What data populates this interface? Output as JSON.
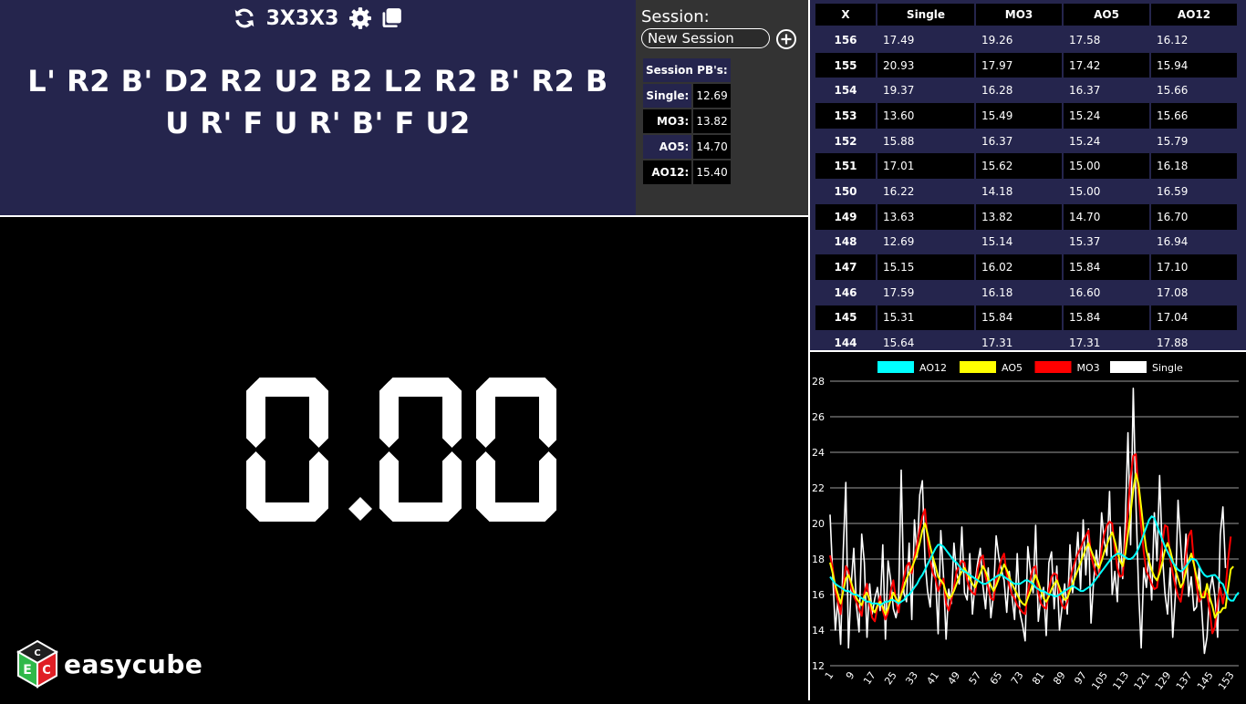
{
  "header": {
    "puzzle": "3X3X3",
    "icons": [
      "refresh-icon",
      "gear-icon",
      "copy-icon"
    ]
  },
  "scramble": "L' R2 B' D2 R2 U2 B2 L2 R2 B' R2 B U R' F U R' B' F U2",
  "session": {
    "title": "Session:",
    "current": "New Session",
    "pb_title": "Session PB's:",
    "pbs": [
      {
        "label": "Single:",
        "value": "12.69"
      },
      {
        "label": "MO3:",
        "value": "13.82"
      },
      {
        "label": "AO5:",
        "value": "14.70"
      },
      {
        "label": "AO12:",
        "value": "15.40"
      }
    ]
  },
  "timer": {
    "display": "0.00"
  },
  "logo": {
    "text": "easycube"
  },
  "times_table": {
    "columns": [
      "X",
      "Single",
      "MO3",
      "AO5",
      "AO12"
    ],
    "rows": [
      [
        "156",
        "17.49",
        "19.26",
        "17.58",
        "16.12"
      ],
      [
        "155",
        "20.93",
        "17.97",
        "17.42",
        "15.94"
      ],
      [
        "154",
        "19.37",
        "16.28",
        "16.37",
        "15.66"
      ],
      [
        "153",
        "13.60",
        "15.49",
        "15.24",
        "15.66"
      ],
      [
        "152",
        "15.88",
        "16.37",
        "15.24",
        "15.79"
      ],
      [
        "151",
        "17.01",
        "15.62",
        "15.00",
        "16.18"
      ],
      [
        "150",
        "16.22",
        "14.18",
        "15.00",
        "16.59"
      ],
      [
        "149",
        "13.63",
        "13.82",
        "14.70",
        "16.70"
      ],
      [
        "148",
        "12.69",
        "15.14",
        "15.37",
        "16.94"
      ],
      [
        "147",
        "15.15",
        "16.02",
        "15.84",
        "17.10"
      ],
      [
        "146",
        "17.59",
        "16.18",
        "16.60",
        "17.08"
      ],
      [
        "145",
        "15.31",
        "15.84",
        "15.84",
        "17.04"
      ],
      [
        "144",
        "15.64",
        "17.31",
        "17.31",
        "17.88"
      ]
    ]
  },
  "chart_data": {
    "type": "line",
    "ylim": [
      12,
      28
    ],
    "yticks": [
      12,
      14,
      16,
      18,
      20,
      22,
      24,
      26,
      28
    ],
    "xticks": [
      1,
      9,
      17,
      25,
      33,
      41,
      49,
      57,
      65,
      73,
      81,
      89,
      97,
      105,
      113,
      121,
      129,
      137,
      145,
      153
    ],
    "xlim": [
      1,
      156
    ],
    "grid": true,
    "legend_position": "top",
    "series": [
      {
        "name": "AO12",
        "color": "#00ffff",
        "values": [
          17.0,
          16.8,
          16.6,
          16.5,
          16.4,
          16.3,
          16.2,
          16.2,
          16.1,
          16.0,
          16.0,
          15.9,
          15.8,
          15.7,
          15.6,
          15.6,
          15.5,
          15.5,
          15.5,
          15.4,
          15.5,
          15.6,
          15.6,
          15.7,
          15.7,
          15.6,
          15.5,
          15.6,
          15.7,
          15.9,
          16.0,
          16.2,
          16.4,
          16.6,
          16.9,
          17.1,
          17.4,
          17.7,
          18.0,
          18.3,
          18.6,
          18.8,
          18.8,
          18.7,
          18.5,
          18.3,
          18.1,
          17.9,
          17.8,
          17.6,
          17.4,
          17.3,
          17.2,
          17.1,
          17.0,
          16.9,
          16.8,
          16.7,
          16.6,
          16.6,
          16.7,
          16.8,
          16.9,
          17.0,
          17.1,
          17.1,
          17.0,
          16.9,
          16.8,
          16.7,
          16.6,
          16.6,
          16.6,
          16.7,
          16.8,
          16.8,
          16.7,
          16.6,
          16.4,
          16.3,
          16.2,
          16.2,
          16.1,
          16.0,
          16.0,
          15.9,
          15.9,
          16.0,
          16.1,
          16.2,
          16.3,
          16.4,
          16.5,
          16.4,
          16.3,
          16.2,
          16.2,
          16.3,
          16.4,
          16.5,
          16.7,
          16.9,
          17.1,
          17.3,
          17.5,
          17.7,
          17.9,
          18.1,
          18.2,
          18.3,
          18.3,
          18.2,
          18.1,
          18.0,
          18.0,
          18.1,
          18.3,
          18.6,
          19.0,
          19.4,
          19.8,
          20.2,
          20.4,
          20.3,
          19.9,
          19.5,
          19.1,
          18.7,
          18.4,
          18.1,
          17.8,
          17.6,
          17.4,
          17.3,
          17.4,
          17.6,
          17.8,
          18.0,
          18.0,
          17.9,
          17.6,
          17.3,
          17.1,
          17.0,
          17.04,
          17.08,
          17.1,
          16.94,
          16.7,
          16.59,
          16.18,
          15.79,
          15.66,
          15.66,
          15.94,
          16.12
        ]
      },
      {
        "name": "AO5",
        "color": "#ffff00",
        "values": [
          17.8,
          17.2,
          16.5,
          16.0,
          15.5,
          16.2,
          16.9,
          17.1,
          16.7,
          16.2,
          15.8,
          15.6,
          15.4,
          15.9,
          16.1,
          15.7,
          15.2,
          15.0,
          15.4,
          15.6,
          15.3,
          14.9,
          15.2,
          15.7,
          16.1,
          15.8,
          15.5,
          16.0,
          16.4,
          16.9,
          17.2,
          17.5,
          17.9,
          18.3,
          18.9,
          19.6,
          20.0,
          19.4,
          18.7,
          18.1,
          17.6,
          17.0,
          16.8,
          16.6,
          16.1,
          15.8,
          15.9,
          16.2,
          16.6,
          17.0,
          17.3,
          17.5,
          17.2,
          16.9,
          16.6,
          16.4,
          16.8,
          17.2,
          17.6,
          17.3,
          16.9,
          16.5,
          16.2,
          16.5,
          16.9,
          17.3,
          17.7,
          17.4,
          17.0,
          16.6,
          16.3,
          16.0,
          15.7,
          15.5,
          15.4,
          15.8,
          16.2,
          16.7,
          17.1,
          16.7,
          16.2,
          15.8,
          15.6,
          15.9,
          16.3,
          16.6,
          16.8,
          16.4,
          16.0,
          15.7,
          15.8,
          16.2,
          16.6,
          17.0,
          17.4,
          17.8,
          18.2,
          18.6,
          18.9,
          18.5,
          18.1,
          17.7,
          17.5,
          17.9,
          18.4,
          18.8,
          19.2,
          19.5,
          19.0,
          18.4,
          17.9,
          17.6,
          18.3,
          19.4,
          20.6,
          21.9,
          22.8,
          22.2,
          20.9,
          19.6,
          18.5,
          17.9,
          17.4,
          17.0,
          16.8,
          17.2,
          17.8,
          18.5,
          18.9,
          18.5,
          17.9,
          17.4,
          16.9,
          16.4,
          16.7,
          17.3,
          17.9,
          18.3,
          17.7,
          17.0,
          16.4,
          15.84,
          15.84,
          16.6,
          15.84,
          15.37,
          14.7,
          15.0,
          15.0,
          15.24,
          15.24,
          16.37,
          17.42,
          17.58
        ]
      },
      {
        "name": "MO3",
        "color": "#ff0000",
        "values": [
          18.2,
          17.5,
          16.2,
          15.6,
          14.9,
          16.5,
          17.6,
          17.3,
          16.4,
          15.9,
          15.6,
          15.2,
          14.8,
          16.1,
          16.6,
          15.4,
          14.7,
          14.5,
          15.3,
          15.9,
          15.1,
          14.6,
          15.0,
          16.2,
          16.8,
          15.6,
          15.0,
          16.1,
          16.9,
          17.6,
          17.8,
          17.2,
          18.1,
          18.8,
          19.7,
          20.4,
          20.8,
          19.1,
          17.9,
          17.2,
          16.9,
          16.2,
          16.6,
          16.9,
          15.5,
          15.1,
          15.7,
          16.4,
          17.3,
          17.6,
          17.9,
          17.8,
          16.8,
          16.3,
          16.1,
          16.0,
          17.4,
          18.0,
          18.2,
          17.0,
          16.4,
          15.8,
          15.7,
          16.8,
          17.4,
          18.0,
          18.3,
          17.1,
          16.5,
          16.0,
          15.8,
          15.4,
          15.2,
          15.0,
          14.9,
          16.1,
          16.9,
          17.5,
          17.6,
          16.1,
          15.5,
          15.3,
          15.2,
          16.3,
          17.0,
          17.2,
          17.1,
          15.9,
          15.4,
          15.2,
          15.6,
          16.8,
          17.4,
          17.9,
          18.3,
          18.6,
          19.0,
          19.3,
          19.6,
          18.2,
          17.6,
          17.1,
          17.0,
          18.6,
          19.4,
          19.9,
          20.1,
          20.0,
          18.6,
          17.5,
          17.0,
          17.1,
          18.9,
          20.8,
          22.6,
          23.8,
          23.9,
          21.7,
          19.8,
          18.4,
          17.3,
          17.0,
          16.6,
          16.3,
          16.4,
          17.6,
          18.9,
          19.9,
          19.8,
          18.0,
          17.2,
          16.5,
          15.9,
          15.6,
          16.6,
          18.2,
          19.3,
          19.6,
          17.8,
          16.5,
          15.6,
          15.84,
          16.18,
          16.02,
          15.14,
          13.82,
          14.18,
          15.62,
          16.37,
          15.49,
          16.28,
          17.97,
          19.26
        ]
      },
      {
        "name": "Single",
        "color": "#ffffff",
        "values": [
          20.5,
          17.1,
          14.0,
          15.8,
          13.2,
          18.5,
          22.3,
          13.0,
          16.5,
          18.6,
          15.4,
          13.9,
          19.4,
          17.8,
          13.6,
          16.6,
          14.9,
          15.8,
          16.4,
          15.1,
          18.8,
          13.5,
          17.9,
          16.8,
          15.2,
          14.7,
          15.5,
          23.0,
          16.1,
          15.6,
          18.9,
          14.6,
          20.2,
          18.1,
          21.6,
          22.4,
          17.9,
          16.2,
          15.3,
          18.0,
          17.0,
          13.8,
          19.6,
          17.1,
          13.5,
          16.3,
          15.5,
          18.9,
          17.2,
          16.6,
          19.8,
          16.1,
          15.7,
          18.3,
          14.9,
          16.7,
          17.8,
          18.6,
          16.5,
          15.2,
          17.5,
          14.7,
          16.0,
          19.3,
          18.1,
          17.4,
          16.8,
          15.0,
          17.3,
          15.9,
          14.6,
          18.3,
          15.0,
          14.3,
          13.4,
          18.7,
          17.3,
          16.1,
          19.9,
          14.5,
          15.9,
          16.4,
          13.7,
          17.8,
          18.4,
          15.2,
          17.6,
          14.0,
          15.3,
          16.6,
          14.9,
          18.8,
          16.1,
          17.4,
          19.5,
          16.3,
          20.2,
          17.1,
          19.7,
          14.4,
          16.8,
          18.5,
          17.2,
          20.6,
          19.0,
          18.2,
          21.8,
          16.0,
          17.3,
          15.6,
          19.8,
          16.9,
          20.1,
          25.1,
          18.8,
          27.6,
          21.2,
          16.3,
          13.0,
          17.5,
          16.4,
          18.3,
          15.7,
          20.6,
          17.9,
          22.7,
          18.4,
          16.1,
          14.9,
          17.5,
          13.6,
          16.0,
          21.3,
          18.8,
          16.5,
          19.4,
          15.9,
          17.0,
          15.1,
          15.31,
          17.59,
          15.15,
          12.69,
          13.63,
          16.22,
          17.01,
          15.88,
          13.6,
          19.37,
          20.93,
          17.49
        ]
      }
    ]
  }
}
